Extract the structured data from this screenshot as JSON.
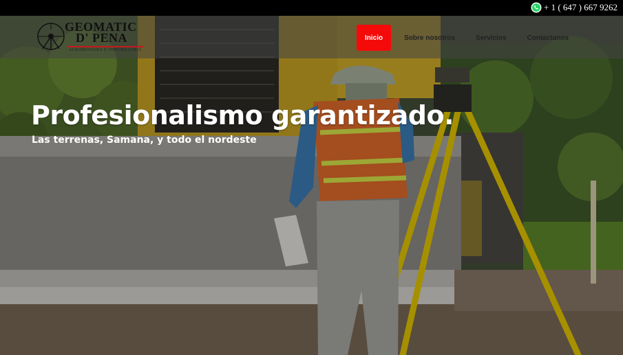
{
  "topbar": {
    "phone": "+ 1 ( 647 ) 667 9262",
    "phone_icon": "whatsapp-icon"
  },
  "logo": {
    "line1": "GEOMATIC",
    "line2": "D' PENA",
    "tagline": "AGRIMENSURA E INMOBILIARIA",
    "accent": "#c8161d"
  },
  "nav": {
    "items": [
      {
        "label": "Inicio",
        "active": true
      },
      {
        "label": "Sobre nosotros",
        "active": false
      },
      {
        "label": "Servicios",
        "active": false
      },
      {
        "label": "Contactanos",
        "active": false
      }
    ],
    "active_color": "#f50a0a"
  },
  "hero": {
    "headline": "Profesionalismo garantizado.",
    "subline": "Las terrenas, Samana, y todo el nordeste"
  }
}
